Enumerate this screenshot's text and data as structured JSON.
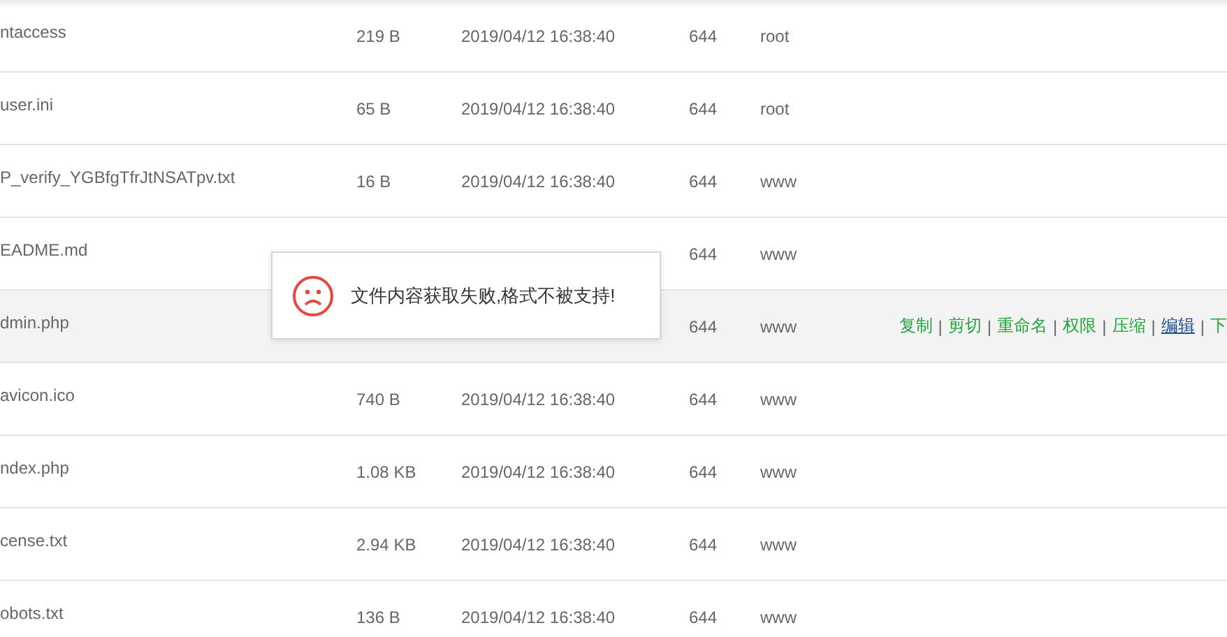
{
  "files": [
    {
      "name": "ntaccess",
      "size": "219 B",
      "modified": "2019/04/12 16:38:40",
      "permission": "644",
      "owner": "root",
      "selected": false
    },
    {
      "name": "user.ini",
      "size": "65 B",
      "modified": "2019/04/12 16:38:40",
      "permission": "644",
      "owner": "root",
      "selected": false
    },
    {
      "name": "P_verify_YGBfgTfrJtNSATpv.txt",
      "size": "16 B",
      "modified": "2019/04/12 16:38:40",
      "permission": "644",
      "owner": "www",
      "selected": false
    },
    {
      "name": "EADME.md",
      "permission": "644",
      "owner": "www",
      "selected": false
    },
    {
      "name": "dmin.php",
      "permission": "644",
      "owner": "www",
      "selected": true,
      "actions": [
        {
          "label": "复制",
          "hovered": false
        },
        {
          "label": "剪切",
          "hovered": false
        },
        {
          "label": "重命名",
          "hovered": false
        },
        {
          "label": "权限",
          "hovered": false
        },
        {
          "label": "压缩",
          "hovered": false
        },
        {
          "label": "编辑",
          "hovered": true
        },
        {
          "label": "下",
          "hovered": false
        }
      ],
      "separator": "|"
    },
    {
      "name": "avicon.ico",
      "size": "740 B",
      "modified": "2019/04/12 16:38:40",
      "permission": "644",
      "owner": "www",
      "selected": false
    },
    {
      "name": "ndex.php",
      "size": "1.08 KB",
      "modified": "2019/04/12 16:38:40",
      "permission": "644",
      "owner": "www",
      "selected": false
    },
    {
      "name": "cense.txt",
      "size": "2.94 KB",
      "modified": "2019/04/12 16:38:40",
      "permission": "644",
      "owner": "www",
      "selected": false
    },
    {
      "name": "obots.txt",
      "size": "136 B",
      "modified": "2019/04/12 16:38:40",
      "permission": "644",
      "owner": "www",
      "selected": false
    }
  ],
  "toast": {
    "message": "文件内容获取失败,格式不被支持!"
  }
}
